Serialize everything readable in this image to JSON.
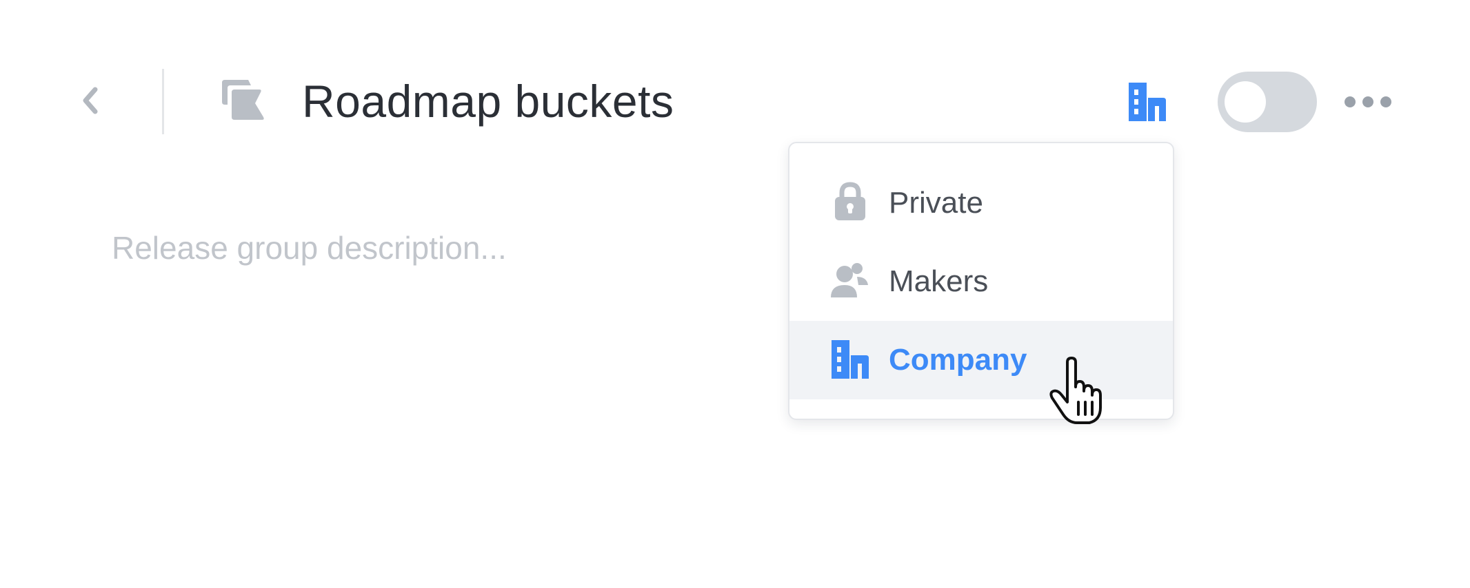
{
  "header": {
    "title": "Roadmap buckets",
    "back_icon": "chevron-left-icon",
    "title_icon": "buckets-icon",
    "visibility_icon": "building-icon",
    "more_icon": "more-horizontal-icon",
    "toggle_on": false
  },
  "description": {
    "value": "",
    "placeholder": "Release group description..."
  },
  "visibility_menu": {
    "items": [
      {
        "label": "Private",
        "icon": "lock-icon",
        "selected": false
      },
      {
        "label": "Makers",
        "icon": "users-icon",
        "selected": false
      },
      {
        "label": "Company",
        "icon": "building-icon",
        "selected": true
      }
    ]
  },
  "colors": {
    "accent": "#3d8af7",
    "icon_gray": "#b9bec5",
    "text": "#2b2f36",
    "toggle_off": "#d5d9de",
    "highlight_bg": "#f1f3f6"
  }
}
